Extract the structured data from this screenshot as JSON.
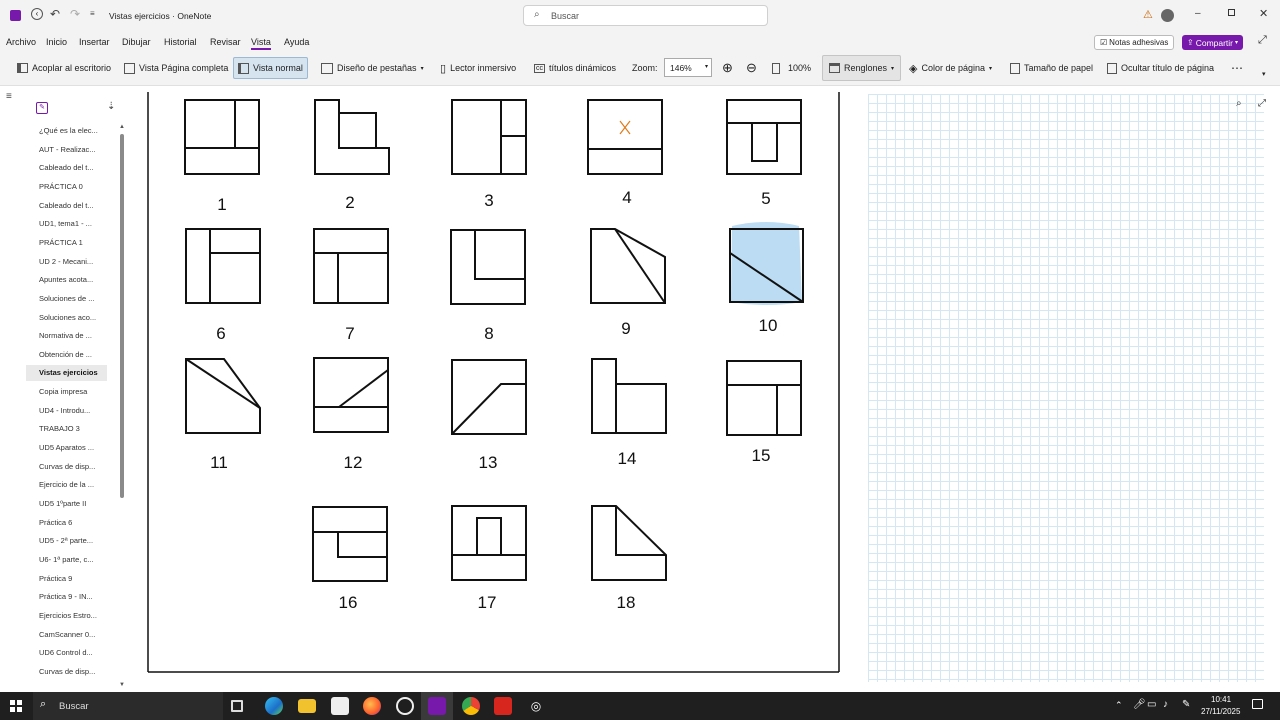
{
  "window": {
    "title": "Vistas ejercicios · OneNote",
    "search_placeholder": "Buscar"
  },
  "menu_tabs": [
    "Archivo",
    "Inicio",
    "Insertar",
    "Dibujar",
    "Historial",
    "Revisar",
    "Vista",
    "Ayuda"
  ],
  "active_tab": "Vista",
  "ribbon_right": {
    "sticky_notes": "Notas adhesivas",
    "share": "Compartir"
  },
  "toolbar": {
    "dock": "Acoplar al escritorio",
    "full_page": "Vista Página completa",
    "normal_view": "Vista normal",
    "tab_layout": "Diseño de pestañas",
    "immersive": "Lector inmersivo",
    "dynamic_titles": "títulos dinámicos",
    "zoom_label": "Zoom:",
    "zoom_value": "146%",
    "hundred": "100%",
    "rule_lines": "Renglones",
    "page_color": "Color de página",
    "paper_size": "Tamaño de papel",
    "hide_title": "Ocultar título de página"
  },
  "sidebar": {
    "pages": [
      "¿Qué es la elec...",
      "AUT - Realizac...",
      "Cableado  del t...",
      "PRÁCTICA 0",
      "Cableado  del t...",
      "UD1, tema1 - ...",
      "PRÁCTICA 1",
      "UD 2  - Mecani...",
      "Apuntes acota...",
      "Soluciones de ...",
      "Soluciones aco...",
      "Normativa de ...",
      "Obtención de ...",
      "Vistas ejercicios",
      "Copia impresa",
      "UD4 - Introdu...",
      "TRABAJO 3",
      "UD5 Aparatos ...",
      "Curvas de disp...",
      "Ejercicio de la ...",
      "UD5 1ºparte II",
      "Práctica 6",
      "UD5  - 2ª parte...",
      "U6- 1ª parte, c...",
      "Práctica 9",
      "Práctica 9 - IN...",
      "Ejercicios Estro...",
      "CamScanner 0...",
      "UD6 Control d...",
      "Curvas de disp..."
    ],
    "selected": "Vistas ejercicios"
  },
  "figure_labels": [
    "1",
    "2",
    "3",
    "4",
    "5",
    "6",
    "7",
    "8",
    "9",
    "10",
    "11",
    "12",
    "13",
    "14",
    "15",
    "16",
    "17",
    "18"
  ],
  "taskbar": {
    "search": "Buscar",
    "time": "10:41",
    "date": "27/11/2025"
  }
}
